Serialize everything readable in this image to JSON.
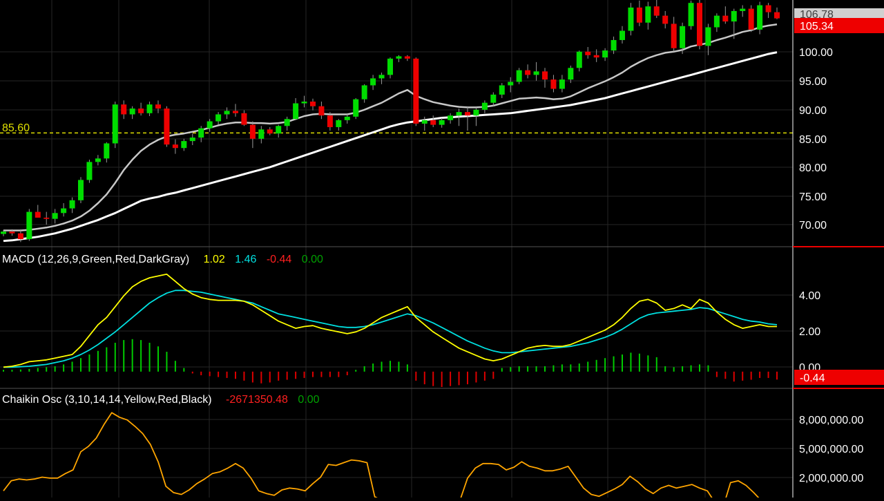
{
  "theme": {
    "background": "#000000",
    "grid": "#262626",
    "axis_text": "#ffffff",
    "up_candle": "#00dd00",
    "down_candle": "#ee0000",
    "ema_fast": "#c8c8c8",
    "ema_slow": "#ffffff",
    "support_line": "#e0e000",
    "macd_line": "#ffff00",
    "signal_line": "#00e0e0",
    "hist_pos": "#00cc00",
    "hist_neg": "#dd0000",
    "chaikin_line": "#ffa500",
    "price_tag_bg": "#ee0000",
    "price_tag_text": "#ffffff",
    "prev_tag_bg": "#d0d0d0"
  },
  "price_panel": {
    "y_ticks": [
      "100.00",
      "95.00",
      "90.00",
      "85.00",
      "80.00",
      "75.00",
      "70.00"
    ],
    "support_label": "85.60",
    "last_price_tag": "105.34",
    "prev_price_tag": "106.78"
  },
  "macd_panel": {
    "title": "MACD (12,26,9,Green,Red,DarkGray)",
    "macd_value": "1.02",
    "signal_value": "1.46",
    "hist_value": "-0.44",
    "zero_value": "0.00",
    "y_ticks": [
      "4.00",
      "2.00",
      "0.00"
    ],
    "hist_tag": "-0.44"
  },
  "chaikin_panel": {
    "title": "Chaikin Osc (3,10,14,14,Yellow,Red,Black)",
    "value": "-2671350.48",
    "zero_value": "0.00",
    "y_ticks": [
      "8,000,000.00",
      "5,000,000.00",
      "2,000,000.00"
    ]
  },
  "chart_data": [
    {
      "type": "candlestick",
      "panel": "price",
      "y_range": [
        66,
        108.5
      ],
      "support_level": 85.6,
      "x_index": [
        0,
        90
      ],
      "ohlc": [
        [
          68.2,
          68.9,
          67.8,
          68.6
        ],
        [
          68.6,
          69.0,
          67.9,
          68.3
        ],
        [
          68.3,
          69.0,
          66.8,
          67.3
        ],
        [
          67.3,
          72.5,
          67.0,
          72.0
        ],
        [
          72.0,
          73.2,
          71.5,
          71.0
        ],
        [
          71.0,
          72.0,
          69.8,
          70.8
        ],
        [
          70.8,
          72.5,
          70.0,
          71.8
        ],
        [
          71.8,
          73.5,
          71.2,
          72.6
        ],
        [
          72.6,
          74.5,
          71.8,
          74.0
        ],
        [
          74.0,
          78.0,
          73.5,
          77.5
        ],
        [
          77.5,
          81.0,
          77.0,
          80.6
        ],
        [
          80.6,
          81.8,
          80.0,
          81.2
        ],
        [
          81.2,
          84.0,
          80.5,
          83.8
        ],
        [
          83.8,
          91.0,
          83.0,
          90.5
        ],
        [
          90.5,
          91.2,
          88.0,
          88.8
        ],
        [
          88.8,
          90.2,
          88.0,
          89.8
        ],
        [
          89.8,
          90.8,
          88.6,
          89.0
        ],
        [
          89.0,
          91.0,
          88.5,
          90.5
        ],
        [
          90.5,
          91.2,
          89.0,
          89.8
        ],
        [
          89.8,
          90.2,
          83.2,
          83.6
        ],
        [
          83.6,
          84.5,
          82.0,
          83.0
        ],
        [
          83.0,
          84.6,
          82.5,
          84.2
        ],
        [
          84.2,
          85.5,
          83.5,
          84.8
        ],
        [
          84.8,
          86.8,
          84.0,
          86.4
        ],
        [
          86.4,
          88.0,
          85.8,
          87.6
        ],
        [
          87.6,
          89.2,
          87.0,
          88.8
        ],
        [
          88.8,
          90.0,
          88.0,
          89.4
        ],
        [
          89.4,
          90.6,
          88.4,
          89.0
        ],
        [
          89.0,
          89.5,
          86.8,
          87.0
        ],
        [
          87.0,
          87.6,
          83.0,
          84.6
        ],
        [
          84.6,
          86.8,
          83.8,
          86.2
        ],
        [
          86.2,
          86.6,
          85.2,
          85.5
        ],
        [
          85.5,
          87.0,
          84.8,
          86.8
        ],
        [
          86.8,
          88.4,
          86.0,
          88.0
        ],
        [
          88.0,
          91.6,
          87.8,
          90.7
        ],
        [
          90.7,
          92.0,
          90.0,
          91.0
        ],
        [
          91.0,
          91.5,
          89.5,
          90.2
        ],
        [
          90.2,
          91.0,
          88.0,
          88.6
        ],
        [
          88.6,
          89.2,
          86.0,
          86.6
        ],
        [
          86.6,
          88.0,
          86.0,
          87.8
        ],
        [
          87.8,
          89.0,
          87.2,
          88.4
        ],
        [
          88.4,
          91.6,
          88.0,
          91.4
        ],
        [
          91.4,
          94.0,
          90.8,
          93.8
        ],
        [
          93.8,
          95.6,
          93.0,
          95.0
        ],
        [
          95.0,
          96.0,
          94.0,
          95.6
        ],
        [
          95.6,
          98.6,
          95.0,
          98.4
        ],
        [
          98.4,
          99.0,
          97.8,
          98.8
        ],
        [
          98.8,
          99.0,
          98.0,
          98.4
        ],
        [
          98.4,
          98.6,
          86.8,
          87.2
        ],
        [
          87.2,
          88.4,
          86.0,
          87.8
        ],
        [
          87.8,
          88.6,
          86.6,
          87.0
        ],
        [
          87.0,
          88.2,
          86.5,
          87.8
        ],
        [
          87.8,
          89.0,
          87.2,
          88.6
        ],
        [
          88.6,
          89.8,
          86.8,
          89.2
        ],
        [
          89.2,
          90.2,
          86.0,
          88.6
        ],
        [
          88.6,
          90.0,
          86.8,
          89.6
        ],
        [
          89.6,
          91.2,
          89.0,
          90.8
        ],
        [
          90.8,
          92.6,
          90.2,
          92.2
        ],
        [
          92.2,
          94.2,
          91.6,
          93.8
        ],
        [
          93.8,
          95.2,
          92.6,
          94.4
        ],
        [
          94.4,
          96.8,
          94.0,
          96.4
        ],
        [
          96.4,
          97.4,
          95.0,
          95.6
        ],
        [
          95.6,
          97.8,
          94.6,
          96.2
        ],
        [
          96.2,
          96.8,
          93.4,
          94.8
        ],
        [
          94.8,
          95.6,
          92.6,
          93.2
        ],
        [
          93.2,
          95.6,
          92.6,
          94.8
        ],
        [
          94.8,
          97.2,
          94.2,
          96.8
        ],
        [
          96.8,
          99.8,
          96.2,
          99.6
        ],
        [
          99.6,
          100.4,
          98.4,
          99.0
        ],
        [
          99.0,
          100.0,
          97.8,
          98.6
        ],
        [
          98.6,
          100.2,
          98.0,
          99.8
        ],
        [
          99.8,
          102.2,
          99.2,
          101.6
        ],
        [
          101.6,
          104.0,
          101.0,
          103.2
        ],
        [
          103.2,
          108.0,
          102.4,
          107.2
        ],
        [
          107.2,
          108.4,
          104.0,
          104.6
        ],
        [
          104.6,
          108.2,
          103.4,
          107.4
        ],
        [
          107.4,
          108.6,
          105.4,
          105.8
        ],
        [
          105.8,
          106.6,
          103.6,
          104.4
        ],
        [
          104.4,
          105.6,
          99.6,
          100.2
        ],
        [
          100.2,
          104.6,
          99.2,
          104.0
        ],
        [
          104.0,
          108.4,
          103.4,
          108.0
        ],
        [
          108.0,
          108.8,
          100.0,
          100.6
        ],
        [
          100.6,
          104.4,
          99.0,
          103.8
        ],
        [
          103.8,
          106.2,
          103.0,
          105.8
        ],
        [
          105.8,
          107.4,
          104.4,
          104.8
        ],
        [
          104.8,
          107.0,
          101.8,
          106.6
        ],
        [
          106.6,
          107.6,
          105.6,
          107.0
        ],
        [
          107.0,
          107.6,
          103.0,
          103.4
        ],
        [
          103.4,
          108.2,
          102.6,
          107.6
        ],
        [
          107.6,
          108.0,
          105.4,
          106.4
        ],
        [
          106.4,
          107.2,
          105.2,
          105.34
        ]
      ],
      "ema_fast": [
        68.8,
        68.8,
        68.8,
        68.9,
        69.1,
        69.3,
        69.6,
        70.0,
        70.5,
        71.2,
        72.2,
        73.5,
        75.0,
        77.0,
        79.2,
        81.0,
        82.5,
        83.6,
        84.4,
        85.0,
        85.3,
        85.5,
        85.8,
        86.1,
        86.5,
        86.9,
        87.2,
        87.4,
        87.4,
        87.3,
        87.3,
        87.2,
        87.3,
        87.5,
        88.0,
        88.5,
        88.8,
        88.9,
        88.8,
        88.8,
        88.8,
        89.1,
        89.6,
        90.2,
        90.8,
        91.6,
        92.4,
        93.0,
        92.0,
        91.4,
        90.9,
        90.6,
        90.3,
        90.1,
        90.0,
        90.0,
        90.1,
        90.3,
        90.7,
        91.1,
        91.5,
        91.6,
        91.7,
        91.6,
        91.4,
        91.5,
        91.9,
        92.6,
        93.3,
        93.9,
        94.5,
        95.2,
        96.0,
        97.0,
        97.8,
        98.5,
        99.0,
        99.4,
        99.6,
        99.9,
        100.5,
        100.8,
        101.1,
        101.6,
        102.0,
        102.5,
        103.0,
        103.3,
        103.8,
        104.1,
        104.3
      ],
      "ema_slow": [
        67.0,
        67.1,
        67.3,
        67.5,
        67.7,
        68.0,
        68.3,
        68.7,
        69.1,
        69.6,
        70.1,
        70.6,
        71.2,
        71.8,
        72.5,
        73.2,
        73.9,
        74.3,
        74.6,
        75.0,
        75.3,
        75.7,
        76.1,
        76.5,
        76.9,
        77.3,
        77.7,
        78.1,
        78.5,
        78.9,
        79.3,
        79.7,
        80.2,
        80.7,
        81.2,
        81.7,
        82.2,
        82.7,
        83.2,
        83.7,
        84.2,
        84.7,
        85.2,
        85.7,
        86.2,
        86.7,
        87.1,
        87.4,
        87.6,
        87.8,
        88.0,
        88.2,
        88.3,
        88.4,
        88.5,
        88.6,
        88.7,
        88.8,
        88.9,
        89.0,
        89.2,
        89.4,
        89.6,
        89.8,
        90.0,
        90.2,
        90.4,
        90.7,
        91.0,
        91.3,
        91.6,
        92.0,
        92.4,
        92.8,
        93.2,
        93.6,
        94.0,
        94.4,
        94.8,
        95.2,
        95.6,
        96.0,
        96.4,
        96.8,
        97.2,
        97.6,
        98.0,
        98.4,
        98.8,
        99.2,
        99.5
      ]
    },
    {
      "type": "line",
      "panel": "macd",
      "y_range": [
        -0.85,
        5.85
      ],
      "series": [
        {
          "name": "MACD",
          "color": "#ffff00",
          "values": [
            0.25,
            0.3,
            0.4,
            0.55,
            0.6,
            0.65,
            0.75,
            0.85,
            0.95,
            1.4,
            2.0,
            2.6,
            3.0,
            3.6,
            4.2,
            4.7,
            5.0,
            5.2,
            5.3,
            5.4,
            5.0,
            4.6,
            4.3,
            4.1,
            4.0,
            3.95,
            3.95,
            3.95,
            3.9,
            3.7,
            3.4,
            3.1,
            2.8,
            2.6,
            2.4,
            2.5,
            2.55,
            2.4,
            2.3,
            2.2,
            2.1,
            2.2,
            2.4,
            2.7,
            3.0,
            3.2,
            3.4,
            3.6,
            3.0,
            2.6,
            2.2,
            1.9,
            1.6,
            1.3,
            1.1,
            0.9,
            0.7,
            0.6,
            0.7,
            0.9,
            1.1,
            1.3,
            1.4,
            1.45,
            1.4,
            1.4,
            1.5,
            1.7,
            1.9,
            2.1,
            2.3,
            2.6,
            3.0,
            3.5,
            3.9,
            4.0,
            3.8,
            3.4,
            3.5,
            3.7,
            3.5,
            4.0,
            3.8,
            3.3,
            2.9,
            2.6,
            2.4,
            2.5,
            2.6,
            2.5,
            2.5
          ]
        },
        {
          "name": "Signal",
          "color": "#00e0e0",
          "values": [
            0.25,
            0.25,
            0.27,
            0.3,
            0.35,
            0.4,
            0.5,
            0.6,
            0.75,
            0.95,
            1.2,
            1.5,
            1.85,
            2.2,
            2.6,
            3.0,
            3.4,
            3.8,
            4.1,
            4.35,
            4.5,
            4.5,
            4.45,
            4.4,
            4.3,
            4.2,
            4.1,
            4.0,
            3.9,
            3.8,
            3.6,
            3.4,
            3.2,
            3.1,
            3.0,
            2.9,
            2.8,
            2.7,
            2.6,
            2.5,
            2.45,
            2.45,
            2.5,
            2.6,
            2.75,
            2.9,
            3.05,
            3.2,
            3.1,
            2.9,
            2.7,
            2.45,
            2.2,
            1.95,
            1.7,
            1.5,
            1.3,
            1.15,
            1.05,
            1.05,
            1.1,
            1.15,
            1.2,
            1.25,
            1.3,
            1.35,
            1.4,
            1.5,
            1.6,
            1.75,
            1.9,
            2.1,
            2.35,
            2.65,
            2.95,
            3.15,
            3.25,
            3.3,
            3.35,
            3.4,
            3.45,
            3.55,
            3.5,
            3.35,
            3.2,
            3.05,
            2.9,
            2.8,
            2.75,
            2.65,
            2.6
          ]
        }
      ],
      "histogram": [
        0.1,
        0.1,
        0.12,
        0.15,
        0.2,
        0.25,
        0.3,
        0.4,
        0.55,
        0.75,
        0.95,
        1.15,
        1.35,
        1.6,
        1.75,
        1.8,
        1.75,
        1.6,
        1.4,
        1.1,
        0.6,
        0.2,
        -0.1,
        -0.2,
        -0.25,
        -0.3,
        -0.35,
        -0.4,
        -0.5,
        -0.6,
        -0.65,
        -0.6,
        -0.5,
        -0.45,
        -0.4,
        -0.35,
        -0.3,
        -0.3,
        -0.3,
        -0.3,
        -0.2,
        0.1,
        0.3,
        0.45,
        0.55,
        0.6,
        0.55,
        0.4,
        -0.5,
        -0.7,
        -0.8,
        -0.85,
        -0.8,
        -0.75,
        -0.7,
        -0.6,
        -0.5,
        -0.4,
        0.2,
        0.25,
        0.3,
        0.3,
        0.3,
        0.3,
        0.35,
        0.4,
        0.4,
        0.45,
        0.55,
        0.65,
        0.75,
        0.85,
        0.95,
        1.05,
        1.0,
        0.9,
        0.8,
        0.3,
        0.25,
        0.3,
        0.35,
        0.4,
        0.35,
        -0.3,
        -0.4,
        -0.55,
        -0.5,
        -0.45,
        -0.35,
        -0.35,
        -0.44
      ]
    },
    {
      "type": "line",
      "panel": "chaikin",
      "y_range": [
        -40000,
        10000000
      ],
      "series": [
        {
          "name": "Chaikin",
          "color": "#ffa500",
          "values": [
            700000,
            1800000,
            2000000,
            1900000,
            2000000,
            2200000,
            2100000,
            2100000,
            2600000,
            3000000,
            5000000,
            5600000,
            6500000,
            8000000,
            9300000,
            8800000,
            8500000,
            7800000,
            7000000,
            5800000,
            3900000,
            1200000,
            500000,
            300000,
            800000,
            1500000,
            2000000,
            2600000,
            2800000,
            3200000,
            3700000,
            3200000,
            2100000,
            700000,
            400000,
            200000,
            800000,
            1000000,
            900000,
            700000,
            1500000,
            2200000,
            3600000,
            3500000,
            3800000,
            4100000,
            4000000,
            3800000,
            50000,
            -400000,
            -800000,
            -1100000,
            -1300000,
            -1500000,
            -1600000,
            -1500000,
            -1300000,
            -1100000,
            -800000,
            -400000,
            2100000,
            3200000,
            3700000,
            3700000,
            3600000,
            3000000,
            3300000,
            3900000,
            3400000,
            3200000,
            2900000,
            2900000,
            3100000,
            3400000,
            2200000,
            1000000,
            300000,
            100000,
            500000,
            900000,
            1400000,
            2300000,
            1700000,
            900000,
            400000,
            1000000,
            1300000,
            1000000,
            1200000,
            1400000,
            1000000,
            700000,
            -600000,
            -1200000,
            1600000,
            1800000,
            1300000,
            500000,
            -400000,
            -800000,
            -1200000
          ]
        }
      ]
    }
  ]
}
